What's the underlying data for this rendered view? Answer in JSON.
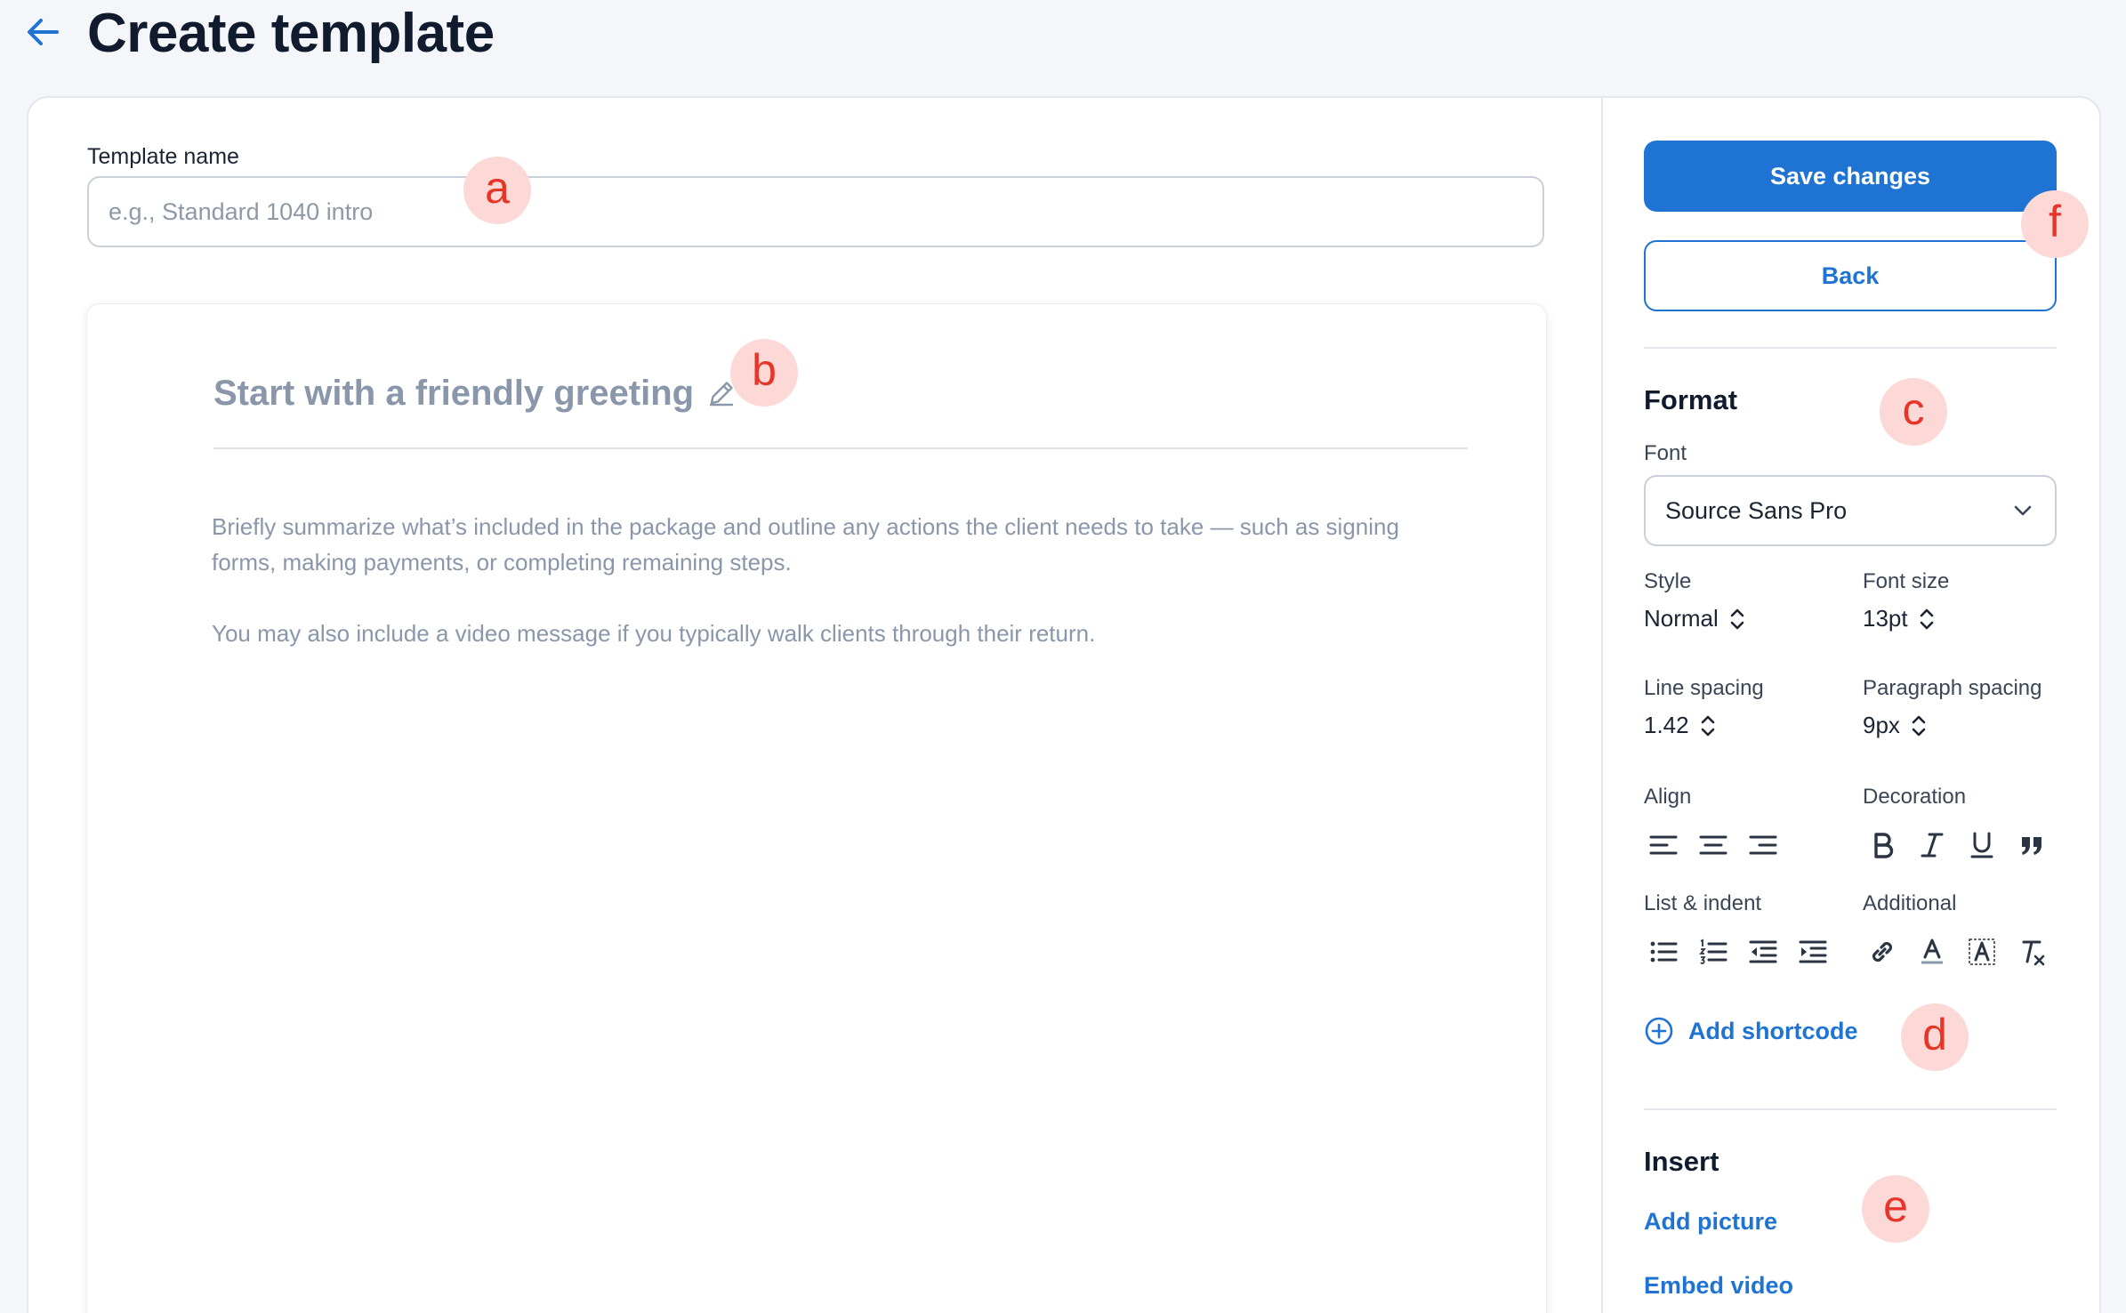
{
  "header": {
    "title": "Create template"
  },
  "template_name": {
    "label": "Template name",
    "placeholder": "e.g., Standard 1040 intro"
  },
  "editor": {
    "greeting": "Start with a friendly greeting",
    "paragraphs": [
      "Briefly summarize what’s included in the package and outline any actions the client needs to take — such as signing forms, making payments, or completing remaining steps.",
      "You may also include a video message if you typically walk clients through their return."
    ]
  },
  "actions": {
    "save_label": "Save changes",
    "back_label": "Back"
  },
  "format": {
    "title": "Format",
    "font_label": "Font",
    "font_value": "Source Sans Pro",
    "style_label": "Style",
    "style_value": "Normal",
    "font_size_label": "Font size",
    "font_size_value": "13pt",
    "line_spacing_label": "Line spacing",
    "line_spacing_value": "1.42",
    "paragraph_spacing_label": "Paragraph spacing",
    "paragraph_spacing_value": "9px",
    "align_label": "Align",
    "decoration_label": "Decoration",
    "list_indent_label": "List & indent",
    "additional_label": "Additional",
    "add_shortcode_label": "Add shortcode"
  },
  "insert": {
    "title": "Insert",
    "add_picture_label": "Add picture",
    "embed_video_label": "Embed video"
  },
  "markers": [
    "a",
    "b",
    "c",
    "d",
    "e",
    "f"
  ],
  "colors": {
    "accent": "#1f74d3",
    "marker_bg": "#fcd9d6",
    "marker_text": "#e8352a"
  }
}
